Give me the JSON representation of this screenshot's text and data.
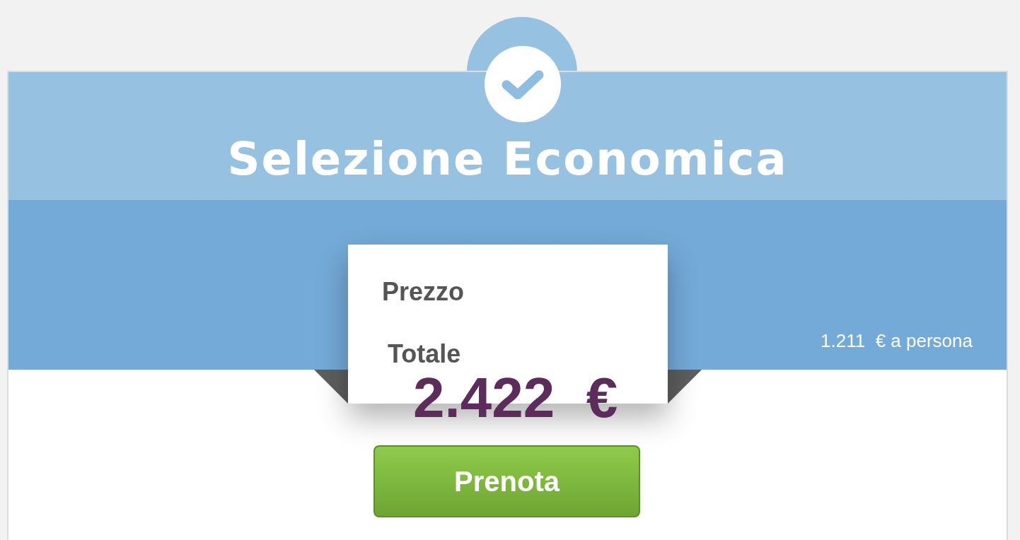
{
  "header": {
    "title": "Selezione Economica"
  },
  "price_box": {
    "label": "Prezzo",
    "sublabel": "Totale",
    "total": "2.422  €"
  },
  "per_person": "1.211  € a persona",
  "book_button": {
    "label": "Prenota"
  }
}
